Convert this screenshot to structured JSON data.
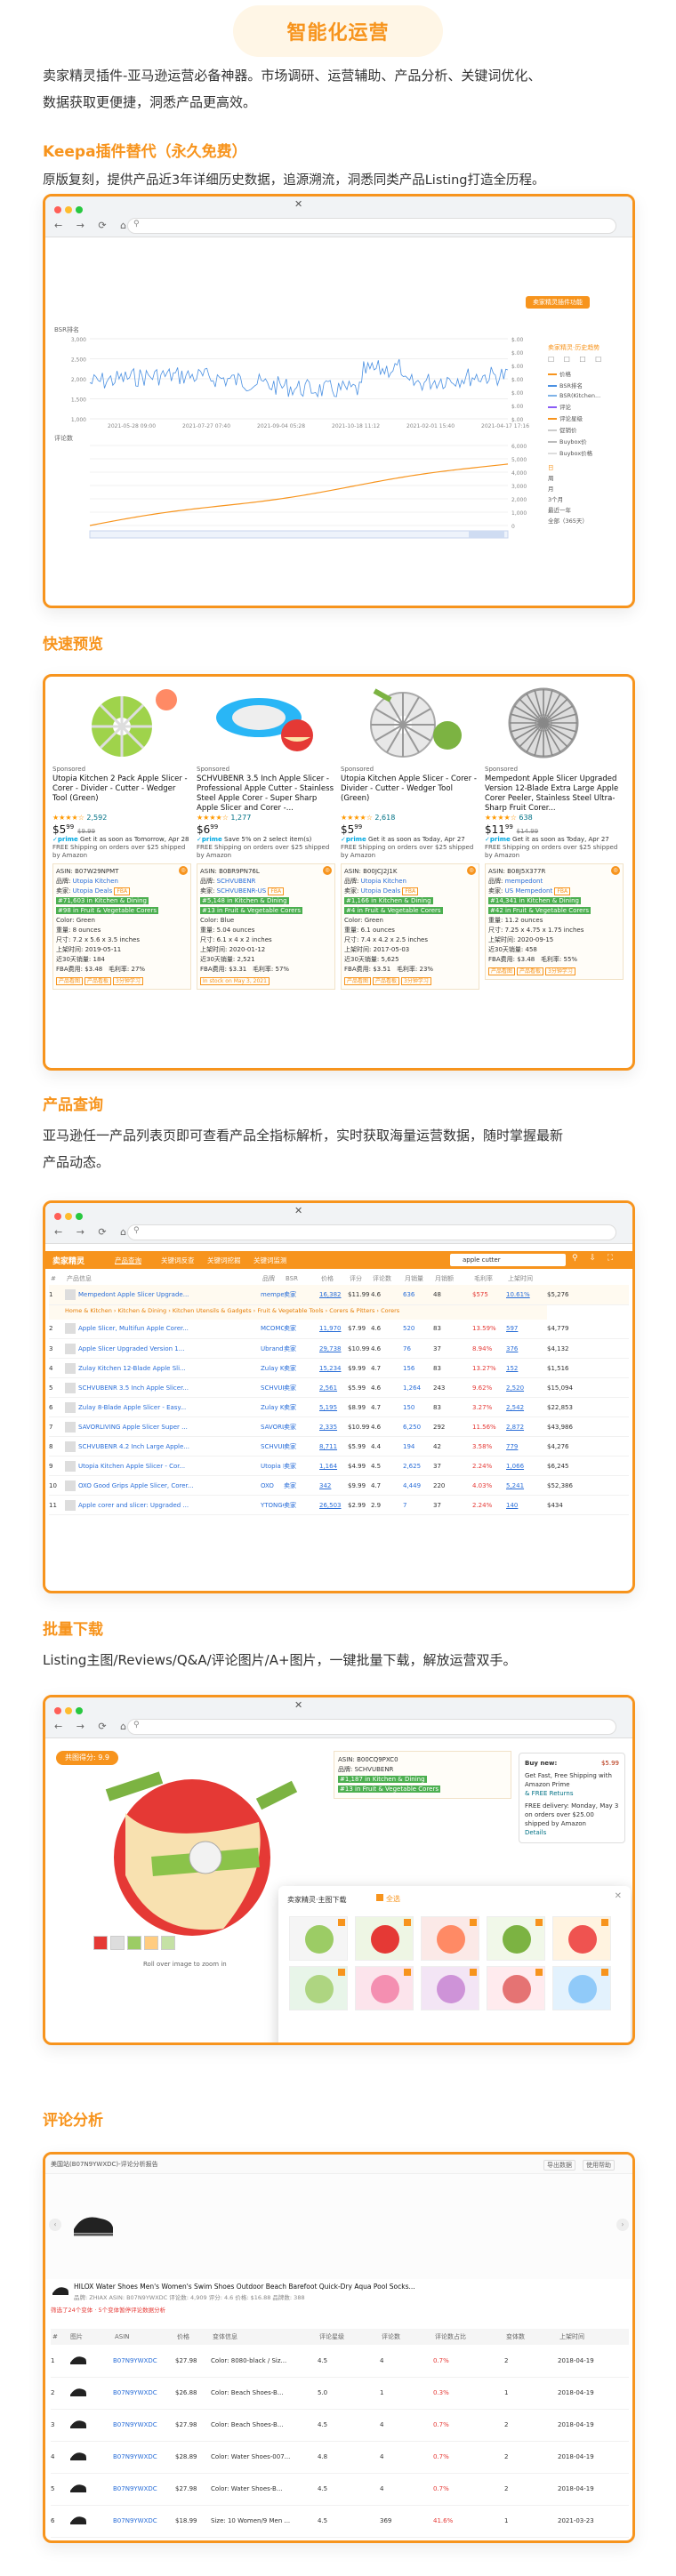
{
  "header": {
    "title": "智能化运营"
  },
  "intro": {
    "line1": "卖家精灵插件-亚马逊运营必备神器。市场调研、运营辅助、产品分析、关键词优化、",
    "line2": "数据获取更便捷，洞悉产品更高效。"
  },
  "keepa": {
    "title": "Keepa插件替代（永久免费）",
    "desc": "原版复刻，提供产品近3年详细历史数据，追源溯流，洞悉同类产品Listing打造全历程。",
    "button": "卖家精灵插件功能",
    "legend_title": "卖家精灵·历史趋势",
    "legend": [
      "价格",
      "BSR排名",
      "BSR(Kitchen...",
      "评论",
      "评论星级",
      "促销价",
      "Buybox价",
      "Buybox价格"
    ],
    "ranges": [
      "日",
      "周",
      "月",
      "3个月",
      "最近一年",
      "全部（365天）"
    ],
    "y_left_top": [
      "3,000",
      "2,500",
      "2,000",
      "1,500",
      "1,000"
    ],
    "y_right_top": [
      "$.00",
      "$.00",
      "$.00",
      "$.00",
      "$.00",
      "$.00",
      "$.00"
    ],
    "y_right_bottom": [
      "6,000",
      "5,000",
      "4,000",
      "3,000",
      "2,000",
      "1,000",
      "0"
    ],
    "x_ticks": [
      "2021-05-28 09:00",
      "2021-07-27 07:40",
      "2021-09-04 05:28",
      "2021-10-18 11:12",
      "2021-02-01 15:40",
      "2021-04-17 17:16"
    ],
    "label_bsr": "BSR排名",
    "label_review": "评论数"
  },
  "quick": {
    "title": "快速预览",
    "products": [
      {
        "name": "Utopia Kitchen 2 Pack Apple Slicer - Corer - Divider - Cutter - Wedger Tool (Green)",
        "rating": "2,592",
        "price": "$5",
        "cents": "99",
        "old": "$9.99",
        "prime": "Get it as soon as Tomorrow, Apr 28",
        "ship": "FREE Shipping on orders over $25 shipped by Amazon",
        "asin": "ASIN: B07W29NPMT",
        "brand": "Utopia Kitchen",
        "seller": "Utopia Deals",
        "bsr1": "#71,603 in Kitchen & Dining",
        "bsr2": "#98 in Fruit & Vegetable Corers",
        "color": "Color: Green",
        "weight": "重量: 8 ounces",
        "size": "尺寸: 7.2 x 5.6 x 3.5 inches",
        "date": "上架时间: 2019-05-11",
        "sales": "近30天销量: 184",
        "fee": "FBA费用: $3.48",
        "margin": "毛利率: 27%",
        "tags": [
          "产品看图",
          "产品看板",
          "3分钟学习"
        ]
      },
      {
        "name": "SCHVUBENR 3.5 Inch Apple Slicer - Professional Apple Cutter - Stainless Steel Apple Corer - Super Sharp Apple Slicer and Corer -...",
        "rating": "1,277",
        "price": "$6",
        "cents": "99",
        "old": "",
        "prime": "Save 5% on 2 select item(s)",
        "ship": "FREE Shipping on orders over $25 shipped by Amazon",
        "asin": "ASIN: B0BR9PN76L",
        "brand": "SCHVUBENR",
        "seller": "SCHVUBENR-US",
        "bsr1": "#5,148 in Kitchen & Dining",
        "bsr2": "#13 in Fruit & Vegetable Corers",
        "color": "Color: Blue",
        "weight": "重量: 5.04 ounces",
        "size": "尺寸: 6.1 x 4 x 2 inches",
        "date": "上架时间: 2020-01-12",
        "sales": "近30天销量: 2,521",
        "fee": "FBA费用: $3.31",
        "margin": "毛利率: 57%",
        "tags": [
          "In stock on May 3, 2021"
        ]
      },
      {
        "name": "Utopia Kitchen Apple Slicer - Corer - Divider - Cutter - Wedger Tool (Green)",
        "rating": "2,618",
        "price": "$5",
        "cents": "99",
        "old": "",
        "prime": "Get it as soon as Today, Apr 27",
        "ship": "FREE Shipping on orders over $25 shipped by Amazon",
        "asin": "ASIN: B00JCJ2J1K",
        "brand": "Utopia Kitchen",
        "seller": "Utopia Deals",
        "bsr1": "#1,166 in Kitchen & Dining",
        "bsr2": "#4 in Fruit & Vegetable Corers",
        "color": "Color: Green",
        "weight": "重量: 6.1 ounces",
        "size": "尺寸: 7.4 x 4.2 x 2.5 inches",
        "date": "上架时间: 2017-05-03",
        "sales": "近30天销量: 5,625",
        "fee": "FBA费用: $3.51",
        "margin": "毛利率: 23%",
        "tags": [
          "产品看图",
          "产品看板",
          "3分钟学习"
        ]
      },
      {
        "name": "Mempedont Apple Slicer Upgraded Version 12-Blade Extra Large Apple Corer Peeler, Stainless Steel Ultra-Sharp Fruit Corer...",
        "rating": "638",
        "price": "$11",
        "cents": "99",
        "old": "$14.99",
        "prime": "Get it as soon as Today, Apr 27",
        "ship": "FREE Shipping on orders over $25 shipped by Amazon",
        "asin": "ASIN: B08J5X377R",
        "brand": "mempedont",
        "seller": "US Mempedont",
        "bsr1": "#14,341 in Kitchen & Dining",
        "bsr2": "#42 in Fruit & Vegetable Corers",
        "color": "",
        "weight": "重量: 11.2 ounces",
        "size": "尺寸: 7.25 x 4.75 x 1.75 inches",
        "date": "上架时间: 2020-09-15",
        "sales": "近30天销量: 458",
        "fee": "FBA费用: $3.48",
        "margin": "毛利率: 55%",
        "tags": [
          "产品看图",
          "产品看板",
          "3分钟学习"
        ]
      }
    ],
    "sponsored": "Sponsored"
  },
  "query": {
    "title": "产品查询",
    "desc1": "亚马逊任一产品列表页即可查看产品全指标解析，实时获取海量运营数据，随时掌握最新",
    "desc2": "产品动态。",
    "logo": "卖家精灵",
    "nav": [
      "产品查询",
      "关键词反查",
      "关键词挖掘",
      "关键词监测"
    ],
    "search": "apple cutter",
    "cols": [
      "#",
      "产品信息",
      "",
      "品牌",
      "BSR",
      "价格",
      "评分",
      "评论数",
      "月销量",
      "月销额",
      "毛利率",
      "上架时间"
    ],
    "rows": [
      [
        "1",
        "Mempedont Apple Slicer Upgrade...",
        "mempedont",
        "卖家",
        "16,382",
        "$11.99",
        "4.6",
        "636",
        "48",
        "$575",
        "10.61%",
        "$5,276"
      ],
      [
        "2",
        "Apple Slicer, Multifun Apple Corer...",
        "MCOMCE",
        "卖家",
        "11,970",
        "$7.99",
        "4.6",
        "520",
        "83",
        "13.59%",
        "597",
        "$4,779"
      ],
      [
        "3",
        "Apple Slicer Upgraded Version 1...",
        "Ubrand",
        "卖家",
        "29,738",
        "$10.99",
        "4.6",
        "76",
        "37",
        "8.94%",
        "376",
        "$4,132"
      ],
      [
        "4",
        "Zulay Kitchen 12-Blade Apple Sli...",
        "Zulay Kit...",
        "卖家",
        "15,234",
        "$9.99",
        "4.7",
        "156",
        "83",
        "13.27%",
        "152",
        "$1,516"
      ],
      [
        "5",
        "SCHVUBENR 3.5 Inch Apple Slicer...",
        "SCHVUBE...",
        "卖家",
        "2,561",
        "$5.99",
        "4.6",
        "1,264",
        "243",
        "9.62%",
        "2,520",
        "$15,094"
      ],
      [
        "6",
        "Zulay 8-Blade Apple Slicer - Easy...",
        "Zulay Kit...",
        "卖家",
        "5,195",
        "$8.99",
        "4.7",
        "150",
        "83",
        "3.27%",
        "2,542",
        "$22,853"
      ],
      [
        "7",
        "SAVORLIVING Apple Slicer Super ...",
        "SAVORLIVI...",
        "卖家",
        "2,335",
        "$10.99",
        "4.6",
        "6,250",
        "292",
        "11.56%",
        "2,872",
        "$43,986"
      ],
      [
        "8",
        "SCHVUBENR 4.2 Inch Large Apple...",
        "SCHVUBE...",
        "卖家",
        "8,711",
        "$5.99",
        "4.4",
        "194",
        "42",
        "3.58%",
        "779",
        "$4,276"
      ],
      [
        "9",
        "Utopia Kitchen Apple Slicer - Cor...",
        "Utopia Kit...",
        "卖家",
        "1,164",
        "$4.99",
        "4.5",
        "2,625",
        "37",
        "2.24%",
        "1,066",
        "$6,245"
      ],
      [
        "10",
        "OXO Good Grips Apple Slicer, Corer...",
        "OXO",
        "卖家",
        "342",
        "$9.99",
        "4.7",
        "4,449",
        "220",
        "4.03%",
        "5,241",
        "$52,386"
      ],
      [
        "11",
        "Apple corer and slicer: Upgraded ...",
        "YTONGG...",
        "卖家",
        "26,503",
        "$2.99",
        "2.9",
        "7",
        "37",
        "2.24%",
        "140",
        "$434"
      ]
    ],
    "expand": "Home & Kitchen › Kitchen & Dining › Kitchen Utensils & Gadgets › Fruit & Vegetable Tools › Corers & Pitters › Corers"
  },
  "bulk": {
    "title": "批量下载",
    "desc": "Listing主图/Reviews/Q&A/评论图片/A+图片，一键批量下载，解放运营双手。",
    "badge": "共图得分: 9.9",
    "hint": "Roll over image to zoom in",
    "popup_title": "卖家精灵·主图下载",
    "select_all": "全选",
    "download": "下载图片",
    "buy_price": "$5.99",
    "buy_now": "Buy new:",
    "free": "Get Fast, Free Shipping with Amazon Prime",
    "free_returns": "& FREE Returns",
    "delivery": "FREE delivery: Monday, May 3 on orders over $25.00 shipped by Amazon",
    "details": "Details",
    "info_rows": [
      "ASIN: B00CQ9PXC0",
      "品牌: SCHVUBENR",
      "#1,187 in Kitchen & Dining",
      "#13 in Fruit & Vegetable Corers"
    ]
  },
  "review": {
    "title": "评论分析",
    "head": "美国站(B07N9YWXDC)-评论分析报告",
    "links": [
      "导出数据",
      "使用帮助"
    ],
    "product": "HILOX Water Shoes Men's Women's Swim Shoes Outdoor Beach Barefoot Quick-Dry Aqua Pool Socks...",
    "meta": "品牌: ZHIAX  ASIN: B07N9YWXDC  评论数: 4,909  评分: 4.6  价格: $16.88  品牌数: 388",
    "note": "筛选了24个变体 · 5个变体暂停评论数据分析",
    "cols": [
      "#",
      "图片",
      "ASIN",
      "价格",
      "变体信息",
      "评论星级",
      "评论数",
      "评论数占比",
      "变体数",
      "上架时间"
    ],
    "rows": [
      [
        "1",
        "B07N9YWXDC",
        "$27.98",
        "Color: 8080-black / Siz...",
        "4.5",
        "4",
        "0.7%",
        "2",
        "2018-04-19"
      ],
      [
        "2",
        "B07N9YWXDC",
        "$26.88",
        "Color: Beach Shoes-B...",
        "5.0",
        "1",
        "0.3%",
        "1",
        "2018-04-19"
      ],
      [
        "3",
        "B07N9YWXDC",
        "$27.98",
        "Color: Beach Shoes-B...",
        "4.5",
        "4",
        "0.7%",
        "2",
        "2018-04-19"
      ],
      [
        "4",
        "B07N9YWXDC",
        "$28.89",
        "Color: Water Shoes-007...",
        "4.8",
        "4",
        "0.7%",
        "2",
        "2018-04-19"
      ],
      [
        "5",
        "B07N9YWXDC",
        "$27.98",
        "Color: Water Shoes-B...",
        "4.5",
        "4",
        "0.7%",
        "2",
        "2018-04-19"
      ],
      [
        "6",
        "B07N9YWXDC",
        "$18.99",
        "Size: 10 Women/9 Men ...",
        "4.5",
        "369",
        "41.6%",
        "1",
        "2021-03-23"
      ]
    ]
  }
}
